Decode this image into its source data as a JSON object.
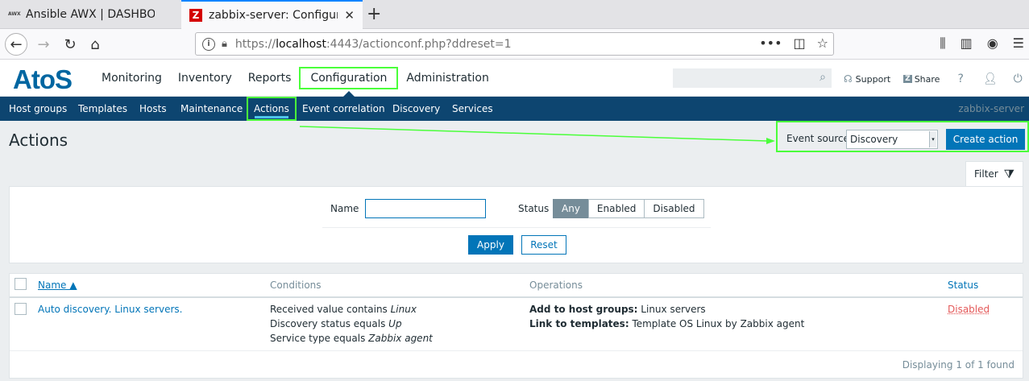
{
  "browser": {
    "tabs": [
      {
        "title": "Ansible AWX | DASHBOARD",
        "favicon": "awx-icon"
      },
      {
        "title": "zabbix-server: Configuration",
        "favicon": "zabbix-icon"
      }
    ],
    "url_prefix": "https://",
    "url_host": "localhost",
    "url_rest": ":4443/actionconf.php?ddreset=1"
  },
  "header": {
    "logo": "AtoS",
    "menu": [
      "Monitoring",
      "Inventory",
      "Reports",
      "Configuration",
      "Administration"
    ],
    "support": "Support",
    "share": "Share",
    "help": "?"
  },
  "submenu": {
    "items": [
      "Host groups",
      "Templates",
      "Hosts",
      "Maintenance",
      "Actions",
      "Event correlation",
      "Discovery",
      "Services"
    ],
    "server": "zabbix-server"
  },
  "page": {
    "title": "Actions",
    "event_source_label": "Event source",
    "event_source_value": "Discovery",
    "create_action": "Create action"
  },
  "filter": {
    "tab_label": "Filter",
    "name_label": "Name",
    "name_value": "",
    "status_label": "Status",
    "status_options": [
      "Any",
      "Enabled",
      "Disabled"
    ],
    "status_selected": "Any",
    "apply": "Apply",
    "reset": "Reset"
  },
  "table": {
    "headers": {
      "name": "Name ▲",
      "conditions": "Conditions",
      "operations": "Operations",
      "status": "Status"
    },
    "rows": [
      {
        "name": "Auto discovery. Linux servers.",
        "conditions": [
          {
            "text": "Received value contains ",
            "em": "Linux"
          },
          {
            "text": "Discovery status equals ",
            "em": "Up"
          },
          {
            "text": "Service type equals ",
            "em": "Zabbix agent"
          }
        ],
        "operations": [
          {
            "bold": "Add to host groups:",
            "text": " Linux servers"
          },
          {
            "bold": "Link to templates:",
            "text": " Template OS Linux by Zabbix agent"
          }
        ],
        "status": "Disabled"
      }
    ],
    "footer": "Displaying 1 of 1 found"
  },
  "colors": {
    "brand": "#0066a1",
    "nav": "#0d4570",
    "accent": "#0275b8",
    "highlight": "#4aff3a",
    "disabled": "#e45959"
  }
}
